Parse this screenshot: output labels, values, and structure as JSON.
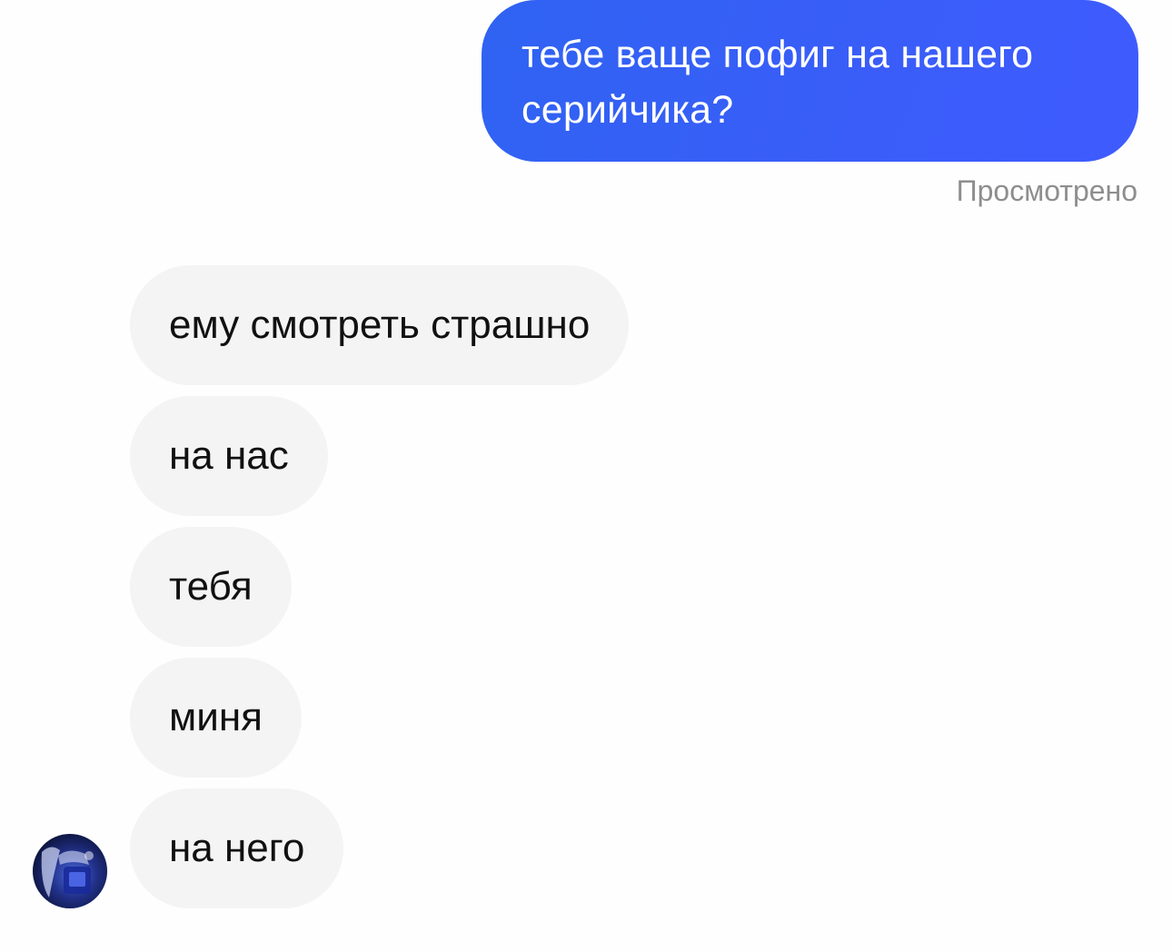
{
  "outgoing": {
    "line1": "тебе ваще пофиг на нашего",
    "line2": "серийчика?",
    "status": "Просмотрено"
  },
  "incoming": [
    {
      "text": "ему смотреть страшно"
    },
    {
      "text": "на нас"
    },
    {
      "text": "тебя"
    },
    {
      "text": "миня"
    },
    {
      "text": "на него"
    }
  ],
  "colors": {
    "outgoing_bubble": "#3a5df9",
    "incoming_bubble": "#f4f4f4",
    "status_text": "#8e8e8e"
  }
}
